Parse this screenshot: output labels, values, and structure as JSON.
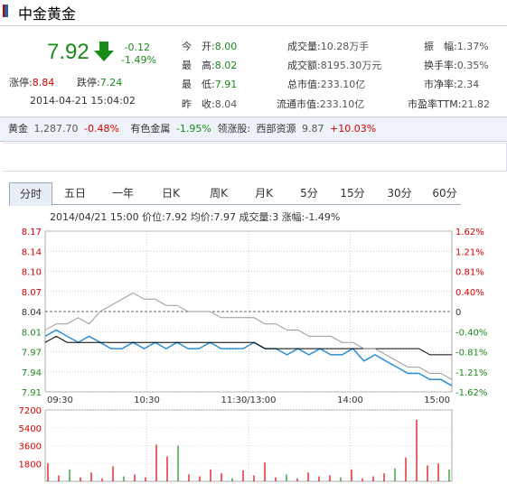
{
  "header": {
    "title": "中金黄金"
  },
  "quote": {
    "price": "7.92",
    "change": "-0.12",
    "change_pct": "-1.49%",
    "limit_up_label": "涨停:",
    "limit_up": "8.84",
    "limit_down_label": "跌停:",
    "limit_down": "7.24",
    "timestamp": "2014-04-21 15:04:02"
  },
  "stats": [
    {
      "label": "今　开:",
      "value": "8.00"
    },
    {
      "label": "最　高:",
      "value": "8.02"
    },
    {
      "label": "最　低:",
      "value": "7.91"
    },
    {
      "label": "昨　收:",
      "value": "8.04"
    },
    {
      "label": "成交量:",
      "value": "10.28万手"
    },
    {
      "label": "成交额:",
      "value": "8195.30万元"
    },
    {
      "label": "总市值:",
      "value": "233.10亿"
    },
    {
      "label": "流通市值:",
      "value": "233.10亿"
    },
    {
      "label": "振　幅:",
      "value": "1.37%"
    },
    {
      "label": "换手率:",
      "value": "0.35%"
    },
    {
      "label": "市净率:",
      "value": "2.34"
    },
    {
      "label": "市盈率TTM:",
      "value": "21.82"
    }
  ],
  "ticker": {
    "gold_label": "黄金",
    "gold_value": "1,287.70",
    "gold_pct": "-0.48%",
    "sector_label": "有色金属",
    "sector_pct": "-1.95%",
    "leader_label": "领涨股:",
    "leader_name": "西部资源",
    "leader_price": "9.87",
    "leader_pct": "+10.03%"
  },
  "tabs": [
    "分时",
    "五日",
    "一年",
    "日K",
    "周K",
    "月K",
    "5分",
    "15分",
    "30分",
    "60分"
  ],
  "active_tab": 0,
  "info_line": "2014/04/21 15:00  价位:7.92  均价:7.97  成交量:3  涨幅:-1.49%",
  "colors": {
    "up": "#d40000",
    "down": "#1a8a1a",
    "price_line": "#2b8fd6",
    "avg_line": "#000000",
    "ref_line": "#999999",
    "volume": "#d40000"
  },
  "chart_data": {
    "type": "line",
    "y_ticks": [
      "8.17",
      "8.14",
      "8.10",
      "8.07",
      "8.04",
      "8.01",
      "7.97",
      "7.94",
      "7.91"
    ],
    "pct_ticks": [
      "1.62%",
      "1.21%",
      "0.81%",
      "0.40%",
      "0",
      "-0.40%",
      "-0.81%",
      "-1.21%",
      "-1.62%"
    ],
    "x_ticks": [
      "09:30",
      "10:30",
      "11:30/13:00",
      "14:00",
      "15:00"
    ],
    "ylim": [
      7.91,
      8.17
    ],
    "prev_close": 8.04,
    "series": [
      {
        "values": [
          8.0,
          8.01,
          8.0,
          7.99,
          8.0,
          7.99,
          7.98,
          7.98,
          7.99,
          7.98,
          7.99,
          7.98,
          7.99,
          7.98,
          7.98,
          7.99,
          7.98,
          7.98,
          7.98,
          7.99,
          7.98,
          7.98,
          7.97,
          7.98,
          7.97,
          7.98,
          7.97,
          7.97,
          7.98,
          7.96,
          7.97,
          7.96,
          7.95,
          7.94,
          7.94,
          7.93,
          7.93,
          7.92
        ]
      },
      {
        "values": [
          7.99,
          8.0,
          7.99,
          7.99,
          7.99,
          7.99,
          7.99,
          7.99,
          7.99,
          7.99,
          7.99,
          7.99,
          7.99,
          7.99,
          7.99,
          7.99,
          7.99,
          7.99,
          7.99,
          7.99,
          7.98,
          7.98,
          7.98,
          7.98,
          7.98,
          7.98,
          7.98,
          7.98,
          7.98,
          7.98,
          7.98,
          7.98,
          7.98,
          7.98,
          7.98,
          7.97,
          7.97,
          7.97
        ]
      },
      {
        "values": [
          8.01,
          8.02,
          8.02,
          8.03,
          8.02,
          8.04,
          8.05,
          8.06,
          8.07,
          8.06,
          8.06,
          8.05,
          8.05,
          8.04,
          8.04,
          8.04,
          8.03,
          8.03,
          8.03,
          8.03,
          8.02,
          8.02,
          8.01,
          8.01,
          8.0,
          8.0,
          8.0,
          7.99,
          7.99,
          7.98,
          7.98,
          7.97,
          7.96,
          7.95,
          7.95,
          7.94,
          7.94,
          7.93
        ]
      }
    ],
    "volume_ticks": [
      "7200",
      "5400",
      "3600",
      "1800"
    ],
    "volume_max": 7200,
    "volume": [
      1800,
      600,
      1200,
      400,
      900,
      300,
      1500,
      500,
      700,
      400,
      3700,
      2500,
      3600,
      700,
      500,
      1200,
      800,
      300,
      1100,
      600,
      1900,
      400,
      700,
      300,
      900,
      500,
      600,
      400,
      1200,
      300,
      500,
      800,
      1300,
      2400,
      6200,
      1600,
      1800,
      1200
    ]
  }
}
